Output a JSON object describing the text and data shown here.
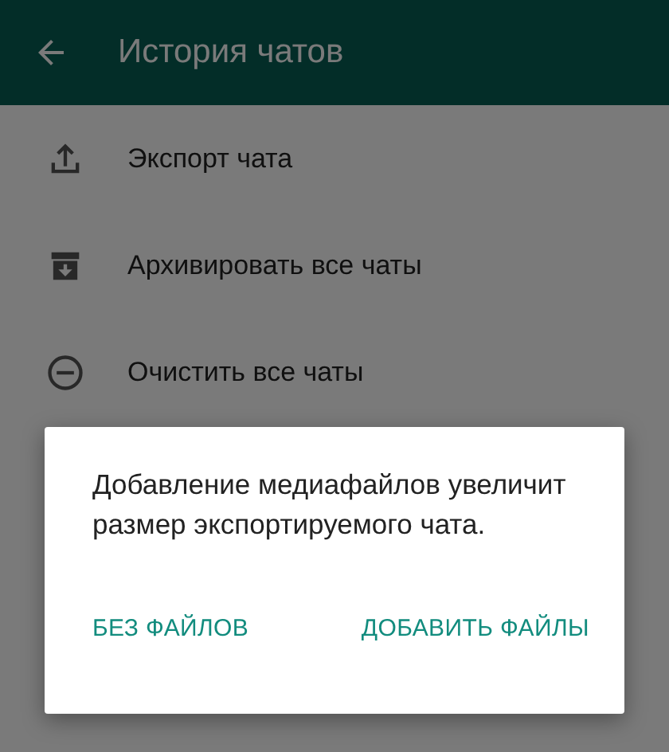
{
  "app_bar": {
    "title": "История чатов"
  },
  "items": [
    {
      "kind": "export",
      "label": "Экспорт чата"
    },
    {
      "kind": "archive",
      "label": "Архивировать все чаты"
    },
    {
      "kind": "clear",
      "label": "Очистить все чаты"
    }
  ],
  "dialog": {
    "message": "Добавление медиафайлов увеличит размер экспортируемого чата.",
    "buttons": [
      "БЕЗ ФАЙЛОВ",
      "ДОБАВИТЬ ФАЙЛЫ"
    ]
  }
}
